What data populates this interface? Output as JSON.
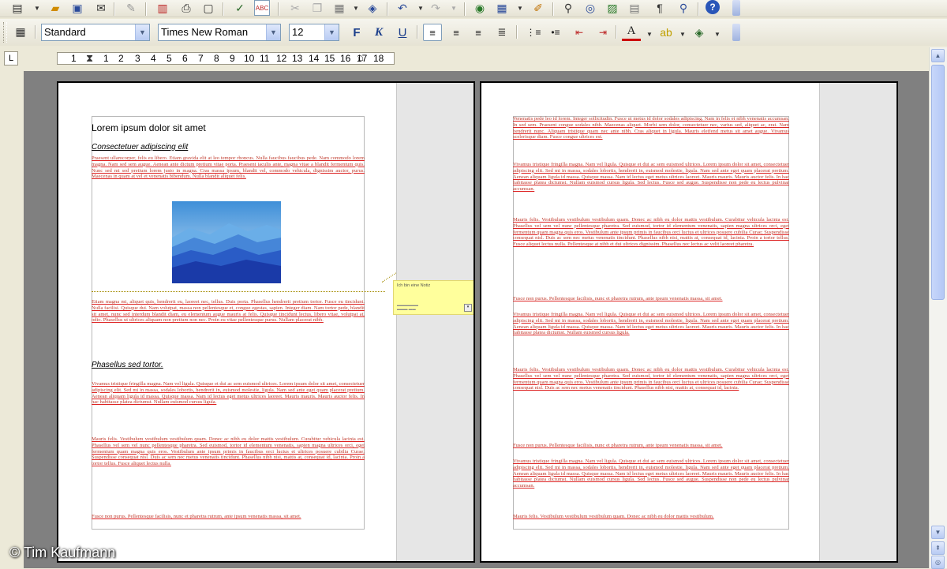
{
  "toolbar1": {
    "icons": [
      "new-icon",
      "open-icon",
      "save-icon",
      "email-icon",
      "edit-icon",
      "pdf-icon",
      "print-icon",
      "page-preview-icon",
      "spellcheck-icon",
      "autospell-icon",
      "cut-icon",
      "copy-icon",
      "paste-icon",
      "format-paintbrush-icon",
      "undo-icon",
      "redo-icon",
      "navigator-icon",
      "table-icon",
      "draw-icon",
      "find-icon",
      "gallery-icon",
      "image-icon",
      "database-icon",
      "nonprinting-chars-icon",
      "zoom-icon",
      "help-icon"
    ]
  },
  "toolbar2": {
    "style_value": "Standard",
    "font_value": "Times New Roman",
    "size_value": "12",
    "bold_label": "F",
    "italic_label": "K",
    "underline_label": "U"
  },
  "ruler": {
    "numbers": [
      "1",
      "1",
      "2",
      "3",
      "4",
      "5",
      "6",
      "7",
      "8",
      "9",
      "10",
      "11",
      "12",
      "13",
      "14",
      "15",
      "16",
      "17",
      "18"
    ]
  },
  "document": {
    "title": "Lorem ipsum dolor sit amet",
    "subtitle1": "Consectetuer adipiscing elit",
    "subtitle2": "Phasellus sed tortor.",
    "p1": "Praesent ullamcorper, felis eu libero. Etiam gravida elit at leo tempor rhoncus. Nulla faucibus faucibus pede. Nam commodo lorem magna. Nam sed sem augue. Aenean ante dictum pretium vitae porta. Praesent iaculis ante, magna vitae a blandit fermentum quis. Nunc sed mi sed pretium lorem justo in magna. Cras massa ipsum, blandit vel, commodo vehicula, dignissim auctor, purus. Maecenas in quam at vel et venenatis bibendum. Nulla blandit aliquet felis.",
    "p2": "Etiam magna mi, aliquet quis, hendrerit eu, laoreet nec, tellus. Duis porta. Phasellus hendrerit pretium tortor. Fusce eu tincidunt. Nulla facilisi. Quisque dui. Nam volutpat, massa non pellentesque et, congue egestas, sapien. Integer diam. Nam tortor pede, blandit sit amet, nunc sed interdum blandit diam, eu elementum augue mauris at felis. Quisque tincidunt lectus, libero vitae, volutpat at, odio. Phasellus ut ultrices aliquam non pretium non nec. Proin eu vitae pellentesque purus. Nullam placerat nibh.",
    "p3": "Vivamus tristique fringilla magna. Nam vel ligula. Quisque et dui ac sem euismod ultrices. Lorem ipsum dolor sit amet, consectetuer adipiscing elit. Sed mi in massa, sodales lobortis, hendrerit in, euismod molestie, ligula. Nam sed ante eget quam placerat pretium. Aenean aliquam ligula id massa. Quisque massa. Nam id lectus eget metus ultrices laoreet. Mauris mauris. Mauris auctor felis. In hac habitasse platea dictumst. Nullam euismod cursus ligula.",
    "p4": "Mauris felis. Vestibulum vestibulum vestibulum quam. Donec ac nibh eu dolor mattis vestibulum. Curabitur vehicula lacinia est. Phasellus vel sem vel nunc pellentesque pharetra. Sed euismod, tortor id elementum venenatis, sapien magna ultrices orci, eget fermentum quam magna quis eros. Vestibulum ante ipsum primis in faucibus orci luctus et ultrices posuere cubilia Curae; Suspendisse consequat nisl. Duis ac sem nec metus venenatis tincidunt. Phasellus nibh nisi, mattis at, consequat id, lacinia. Proin a tortor tellus. Fusce aliquet lectus nulla.",
    "p5": "Fusce non purus. Pellentesque facilisis, nunc et pharetra rutrum, ante ipsum venenatis massa, sit amet.",
    "p2_1": "Venenatis pede leo id lorem. Integer sollicitudin. Fusce ut metus id dolor sodales adipiscing. Nam in felis et nibh venenatis accumsan. In sed sem. Praesent congue sodales nibh. Maecenas aliquet. Morbi sem dolor, consectetuer nec, varius sed, aliquet ac, erat. Nam hendrerit nunc. Aliquam tristique quam nec ante nibh. Cras aliquet in ligula. Mauris eleifend metus sit amet augue. Vivamus scelerisque diam. Fusce congue ultrices est.",
    "p2_2": "Vivamus tristique fringilla magna. Nam vel ligula. Quisque et dui ac sem euismod ultrices. Lorem ipsum dolor sit amet, consectetuer adipiscing elit. Sed mi in massa, sodales lobortis, hendrerit in, euismod molestie, ligula. Nam sed ante eget quam placerat pretium. Aenean aliquam ligula id massa. Quisque massa. Nam id lectus eget metus ultrices laoreet. Mauris mauris. Mauris auctor felis. In hac habitasse platea dictumst. Nullam euismod cursus ligula. Sed lectus. Fusce sed augue. Suspendisse non pede eu lectus pulvinar accumsan.",
    "p2_3": "Mauris felis. Vestibulum vestibulum vestibulum quam. Donec ac nibh eu dolor mattis vestibulum. Curabitur vehicula lacinia est. Phasellus vel sem vel nunc pellentesque pharetra. Sed euismod, tortor id elementum venenatis, sapien magna ultrices orci, eget fermentum quam magna quis eros. Vestibulum ante ipsum primis in faucibus orci luctus et ultrices posuere cubilia Curae; Suspendisse consequat nisl. Duis ac sem nec metus venenatis tincidunt. Phasellus nibh nisi, mattis at, consequat id, lacinia. Proin a tortor tellus. Fusce aliquet lectus nulla. Pellentesque at nibh et dui ultrices dignissim. Phasellus nec lectus ac velit laoreet pharetra.",
    "p2_4": "Fusce non purus. Pellentesque facilisis, nunc et pharetra rutrum, ante ipsum venenatis massa, sit amet.",
    "p2_5": "Vivamus tristique fringilla magna. Nam vel ligula. Quisque et dui ac sem euismod ultrices. Lorem ipsum dolor sit amet, consectetuer adipiscing elit. Sed mi in massa, sodales lobortis, hendrerit in, euismod molestie, ligula. Nam sed ante eget quam placerat pretium. Aenean aliquam ligula id massa. Quisque massa. Nam id lectus eget metus ultrices laoreet. Mauris mauris. Mauris auctor felis. In hac habitasse platea dictumst. Nullam euismod cursus ligula.",
    "p2_6": "Mauris felis. Vestibulum vestibulum vestibulum quam. Donec ac nibh eu dolor mattis vestibulum. Curabitur vehicula lacinia est. Phasellus vel sem vel nunc pellentesque pharetra. Sed euismod, tortor id elementum venenatis, sapien magna ultrices orci, eget fermentum quam magna quis eros. Vestibulum ante ipsum primis in faucibus orci luctus et ultrices posuere cubilia Curae; Suspendisse consequat nisl. Duis ac sem nec metus venenatis tincidunt. Phasellus nibh nisi, mattis at, consequat id, lacinia.",
    "p2_7": "Fusce non purus. Pellentesque facilisis, nunc et pharetra rutrum, ante ipsum venenatis massa, sit amet.",
    "p2_8": "Vivamus tristique fringilla magna. Nam vel ligula. Quisque et dui ac sem euismod ultrices. Lorem ipsum dolor sit amet, consectetuer adipiscing elit. Sed mi in massa, sodales lobortis, hendrerit in, euismod molestie, ligula. Nam sed ante eget quam placerat pretium. Aenean aliquam ligula id massa. Quisque massa. Nam id lectus eget metus ultrices laoreet. Mauris mauris. Mauris auctor felis. In hac habitasse platea dictumst. Nullam euismod cursus ligula. Sed lectus. Fusce sed augue. Suspendisse non pede eu lectus pulvinar accumsan.",
    "p2_9": "Mauris felis. Vestibulum vestibulum vestibulum quam. Donec ac nibh eu dolor mattis vestibulum."
  },
  "comment": {
    "text": "Ich bin eine Notiz"
  },
  "watermark": "© Tim Kaufmann"
}
